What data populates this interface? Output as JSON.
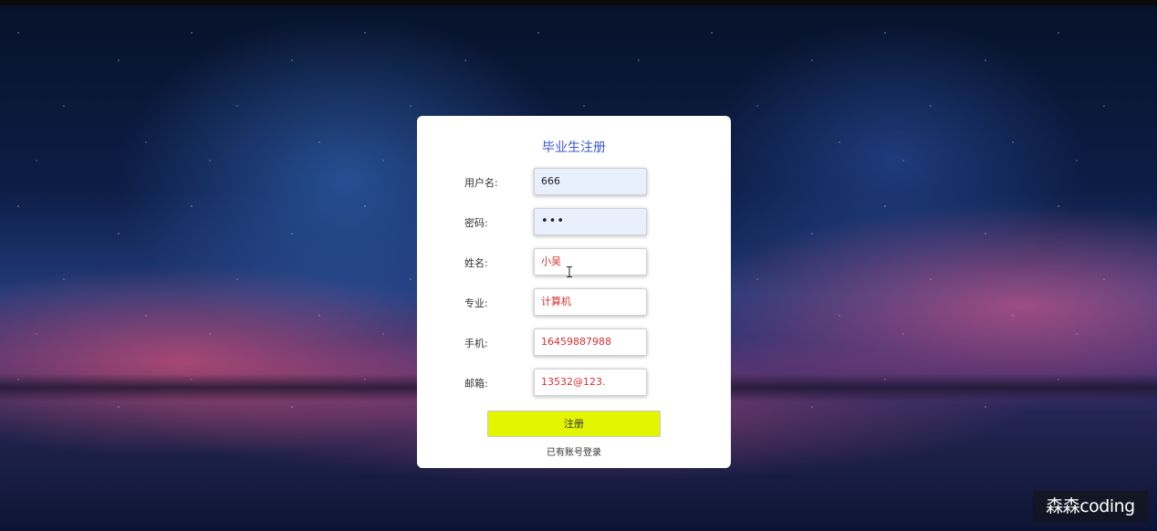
{
  "form": {
    "title": "毕业生注册",
    "fields": [
      {
        "label": "用户名:",
        "value": "666"
      },
      {
        "label": "密码:",
        "value": "•••"
      },
      {
        "label": "姓名:",
        "value": "小吴"
      },
      {
        "label": "专业:",
        "value": "计算机"
      },
      {
        "label": "手机:",
        "value": "16459887988"
      },
      {
        "label": "邮箱:",
        "value": "13532@123."
      }
    ],
    "register_button": "注册",
    "login_link": "已有账号登录"
  },
  "watermark": "森森coding",
  "colors": {
    "title": "#3b57d6",
    "button": "#e4f500",
    "autofill_bg": "#e8f0fe",
    "input_text": "#d93030"
  }
}
